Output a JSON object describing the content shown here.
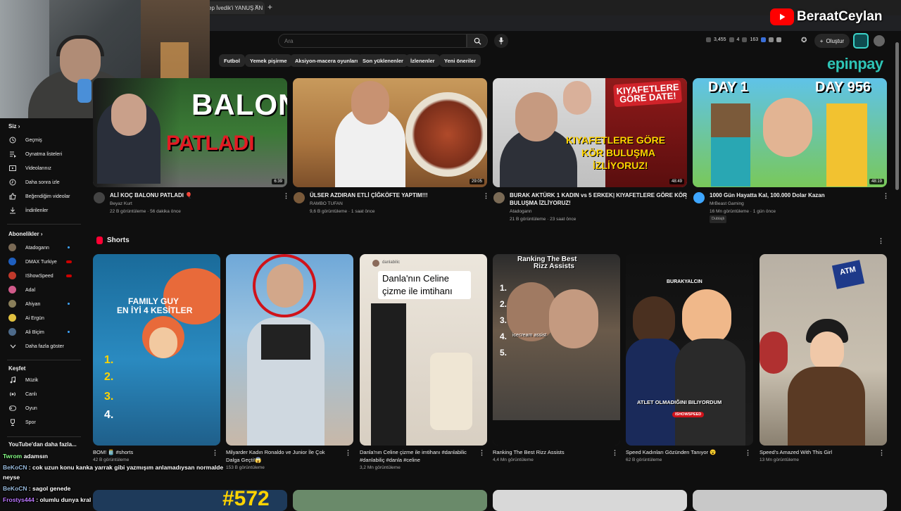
{
  "browser": {
    "tab_title": "ep İvedik'i YANUŞ AN",
    "tab_close": "×",
    "new_tab": "+"
  },
  "header": {
    "search_placeholder": "Ara",
    "stats": [
      "3,455",
      "4",
      "163"
    ],
    "create_label": "Oluştur"
  },
  "chips": [
    "Futbol",
    "Yemek pişirme",
    "Aksiyon-macera oyunları",
    "Son yüklenenler",
    "İzlenenler",
    "Yeni öneriler"
  ],
  "overlay": {
    "channel_brand": "BeraatCeylan",
    "sponsor": "epinpay"
  },
  "sidebar": {
    "you_header": "Siz",
    "you_items": [
      {
        "label": "Geçmiş",
        "icon": "history-icon"
      },
      {
        "label": "Oynatma listeleri",
        "icon": "playlist-icon"
      },
      {
        "label": "Videolarınız",
        "icon": "your-videos-icon"
      },
      {
        "label": "Daha sonra izle",
        "icon": "watch-later-icon"
      },
      {
        "label": "Beğendiğim videolar",
        "icon": "like-icon"
      },
      {
        "label": "İndirilenler",
        "icon": "download-icon"
      }
    ],
    "subs_header": "Abonelikler",
    "subs": [
      {
        "label": "Atadogann",
        "color": "#7a6a55",
        "badge": "dot"
      },
      {
        "label": "DMAX Turkiye",
        "color": "#1f5fbf",
        "badge": "live"
      },
      {
        "label": "IShowSpeed",
        "color": "#c0392b",
        "badge": "live"
      },
      {
        "label": "Adal",
        "color": "#d05a8a",
        "badge": ""
      },
      {
        "label": "Ahiyan",
        "color": "#8a7f5a",
        "badge": "dot"
      },
      {
        "label": "Ai Ergün",
        "color": "#e0c040",
        "badge": ""
      },
      {
        "label": "Ali Biçim",
        "color": "#4d6a8a",
        "badge": "dot"
      }
    ],
    "show_more": "Daha fazla göster",
    "explore_header": "Keşfet",
    "explore_items": [
      {
        "label": "Müzik",
        "icon": "music-icon"
      },
      {
        "label": "Canlı",
        "icon": "live-icon"
      },
      {
        "label": "Oyun",
        "icon": "gaming-icon"
      },
      {
        "label": "Spor",
        "icon": "trophy-icon"
      }
    ],
    "more_from_youtube": "YouTube'dan daha fazla..."
  },
  "videos": [
    {
      "title": "ALİ KOÇ BALONU PATLADI 🎈",
      "channel": "Beyaz Kurt",
      "meta": "22 B görüntüleme · 56 dakika önce",
      "duration": "6:39",
      "thumb_text1": "BALON",
      "thumb_text2": "PATLADI"
    },
    {
      "title": "ÜLSER AZDIRAN ETLİ ÇİĞKÖFTE YAPTIM!!!",
      "channel": "RAMBO TUFAN",
      "meta": "9,6 B görüntüleme · 1 saat önce",
      "duration": "29:05"
    },
    {
      "title_line1": "BURAK AKTÜRK 1 KADIN vs 5 ERKEK| KIYAFETLERE GÖRE KÖR",
      "title_line2": "BULUŞMA İZLİYORUZ!",
      "channel": "Atadogann",
      "meta": "21 B görüntüleme · 23 saat önce",
      "duration": "48:49",
      "thumb_text1": "KIYAFETLERE GÖRE DATE!",
      "thumb_text2": "KIYAFETLERE GÖRE",
      "thumb_text3": "KÖR BULUŞMA",
      "thumb_text4": "İZLİYORUZ!"
    },
    {
      "title": "1000 Gün Hayatta Kal, 100.000 Dolar Kazan",
      "channel": "MrBeast Gaming",
      "meta": "16 Mn görüntüleme · 1 gün önce",
      "badge": "Dublajlı",
      "duration": "48:19",
      "thumb_text1": "DAY 1",
      "thumb_text2": "DAY 956"
    }
  ],
  "shorts_title": "Shorts",
  "shorts": [
    {
      "title": "BOM! 🫙 #shorts",
      "meta": "42 B görüntüleme",
      "thumb_text1": "FAMILY GUY",
      "thumb_text2": "EN İYİ 4 KESİTLER",
      "nums": [
        "1.",
        "2.",
        "3.",
        "4."
      ]
    },
    {
      "title_line1": "Milyarder Kadın Ronaldo ve Junior İle Çok",
      "title_line2": "Dalga Geçti!😱",
      "meta": "153 B görüntüleme"
    },
    {
      "title_line1": "Danla'nın Celine çizme ile imtihanı #danlabilic",
      "title_line2": "#danlabiliç #danla #celine",
      "meta": "3,2 Mn görüntüleme",
      "thumb_text1": "Danla'nın Celine",
      "thumb_text2": "çizme ile imtihanı",
      "handle": "danlabilic"
    },
    {
      "title": "Ranking The Best Rizz Assists",
      "meta": "4,4 Mn görüntüleme",
      "thumb_text1": "Ranking The Best",
      "thumb_text2": "Rizz Assists",
      "nums": [
        "1.",
        "2.",
        "3.",
        "4.",
        "5."
      ],
      "assist": "icecream assist"
    },
    {
      "title": "Speed Kadınları Gözünden Tanıyor 😮",
      "meta": "62 B görüntüleme",
      "thumb_text1": "BURAKYALCIN",
      "thumb_text2": "ATLET OLMADIĞINI BILIYORDUM",
      "thumb_text3": "ISHOWSPEED"
    },
    {
      "title": "Speed's Amazed With This Girl",
      "meta": "13 Mn görüntüleme",
      "thumb_text1": "ATM"
    }
  ],
  "bottom_thumb_text": "#572",
  "chat": [
    {
      "user": "Twrom",
      "text": "adamsın"
    },
    {
      "user": "BeKoCN",
      "text": ": cok uzun konu kanka yarrak gibi yazmışım anlamadıysan normalde"
    },
    {
      "user": "",
      "text": "neyse"
    },
    {
      "user": "BeKoCN",
      "text": ": sagol genede"
    },
    {
      "user": "Frostys444",
      "text": ": olumlu dunya kral"
    }
  ]
}
